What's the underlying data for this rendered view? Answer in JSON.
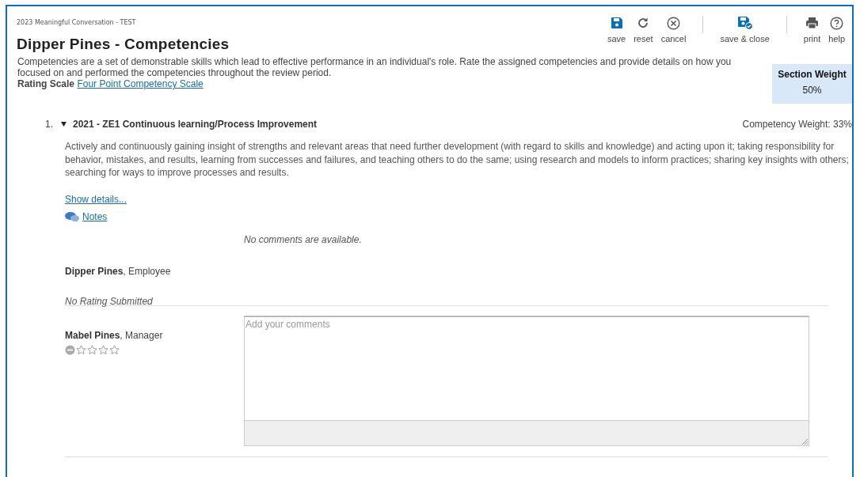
{
  "form_name": "2023 Meaningful Conversation - TEST",
  "title": "Dipper Pines - Competencies",
  "toolbar": [
    {
      "kind": "save",
      "label": "save"
    },
    {
      "kind": "reset",
      "label": "reset"
    },
    {
      "kind": "cancel",
      "label": "cancel"
    },
    {
      "kind": "separator"
    },
    {
      "kind": "save_close",
      "label": "save & close"
    },
    {
      "kind": "separator"
    },
    {
      "kind": "print",
      "label": "print"
    },
    {
      "kind": "help",
      "label": "help"
    }
  ],
  "intro": "Competencies are a set of demonstrable skills which lead to effective performance in an individual's role. Rate the assigned competencies and provide details on how you focused on and performed the competencies throughout the review period.",
  "rating_scale": {
    "label": "Rating Scale",
    "link": "Four Point Competency Scale"
  },
  "section_weight": {
    "label": "Section Weight",
    "value": "50%"
  },
  "competencies": [
    {
      "number": "1.",
      "expanded": true,
      "name": "2021 - ZE1 Continuous learning/Process Improvement",
      "weight": "Competency Weight: 33%",
      "description": "Actively and continuously gaining insight of strengths and relevant areas that need further development (with regard to skills and knowledge) and acting upon it; taking responsibility for behavior, mistakes, and results, learning from successes and failures, and teaching others to do the same; using research and models to inform practices; sharing key insights with others; searching for ways to improve processes and results.",
      "show_details": "Show details...",
      "notes": "Notes",
      "reviewers": [
        {
          "kind": "readonly",
          "name": "Dipper Pines",
          "role": ", Employee",
          "comment": "No comments are available.",
          "rating": "No Rating Submitted"
        },
        {
          "kind": "editable",
          "name": "Mabel Pines",
          "role": ", Manager",
          "placeholder": "Add your comments",
          "stars": 0
        }
      ]
    }
  ]
}
